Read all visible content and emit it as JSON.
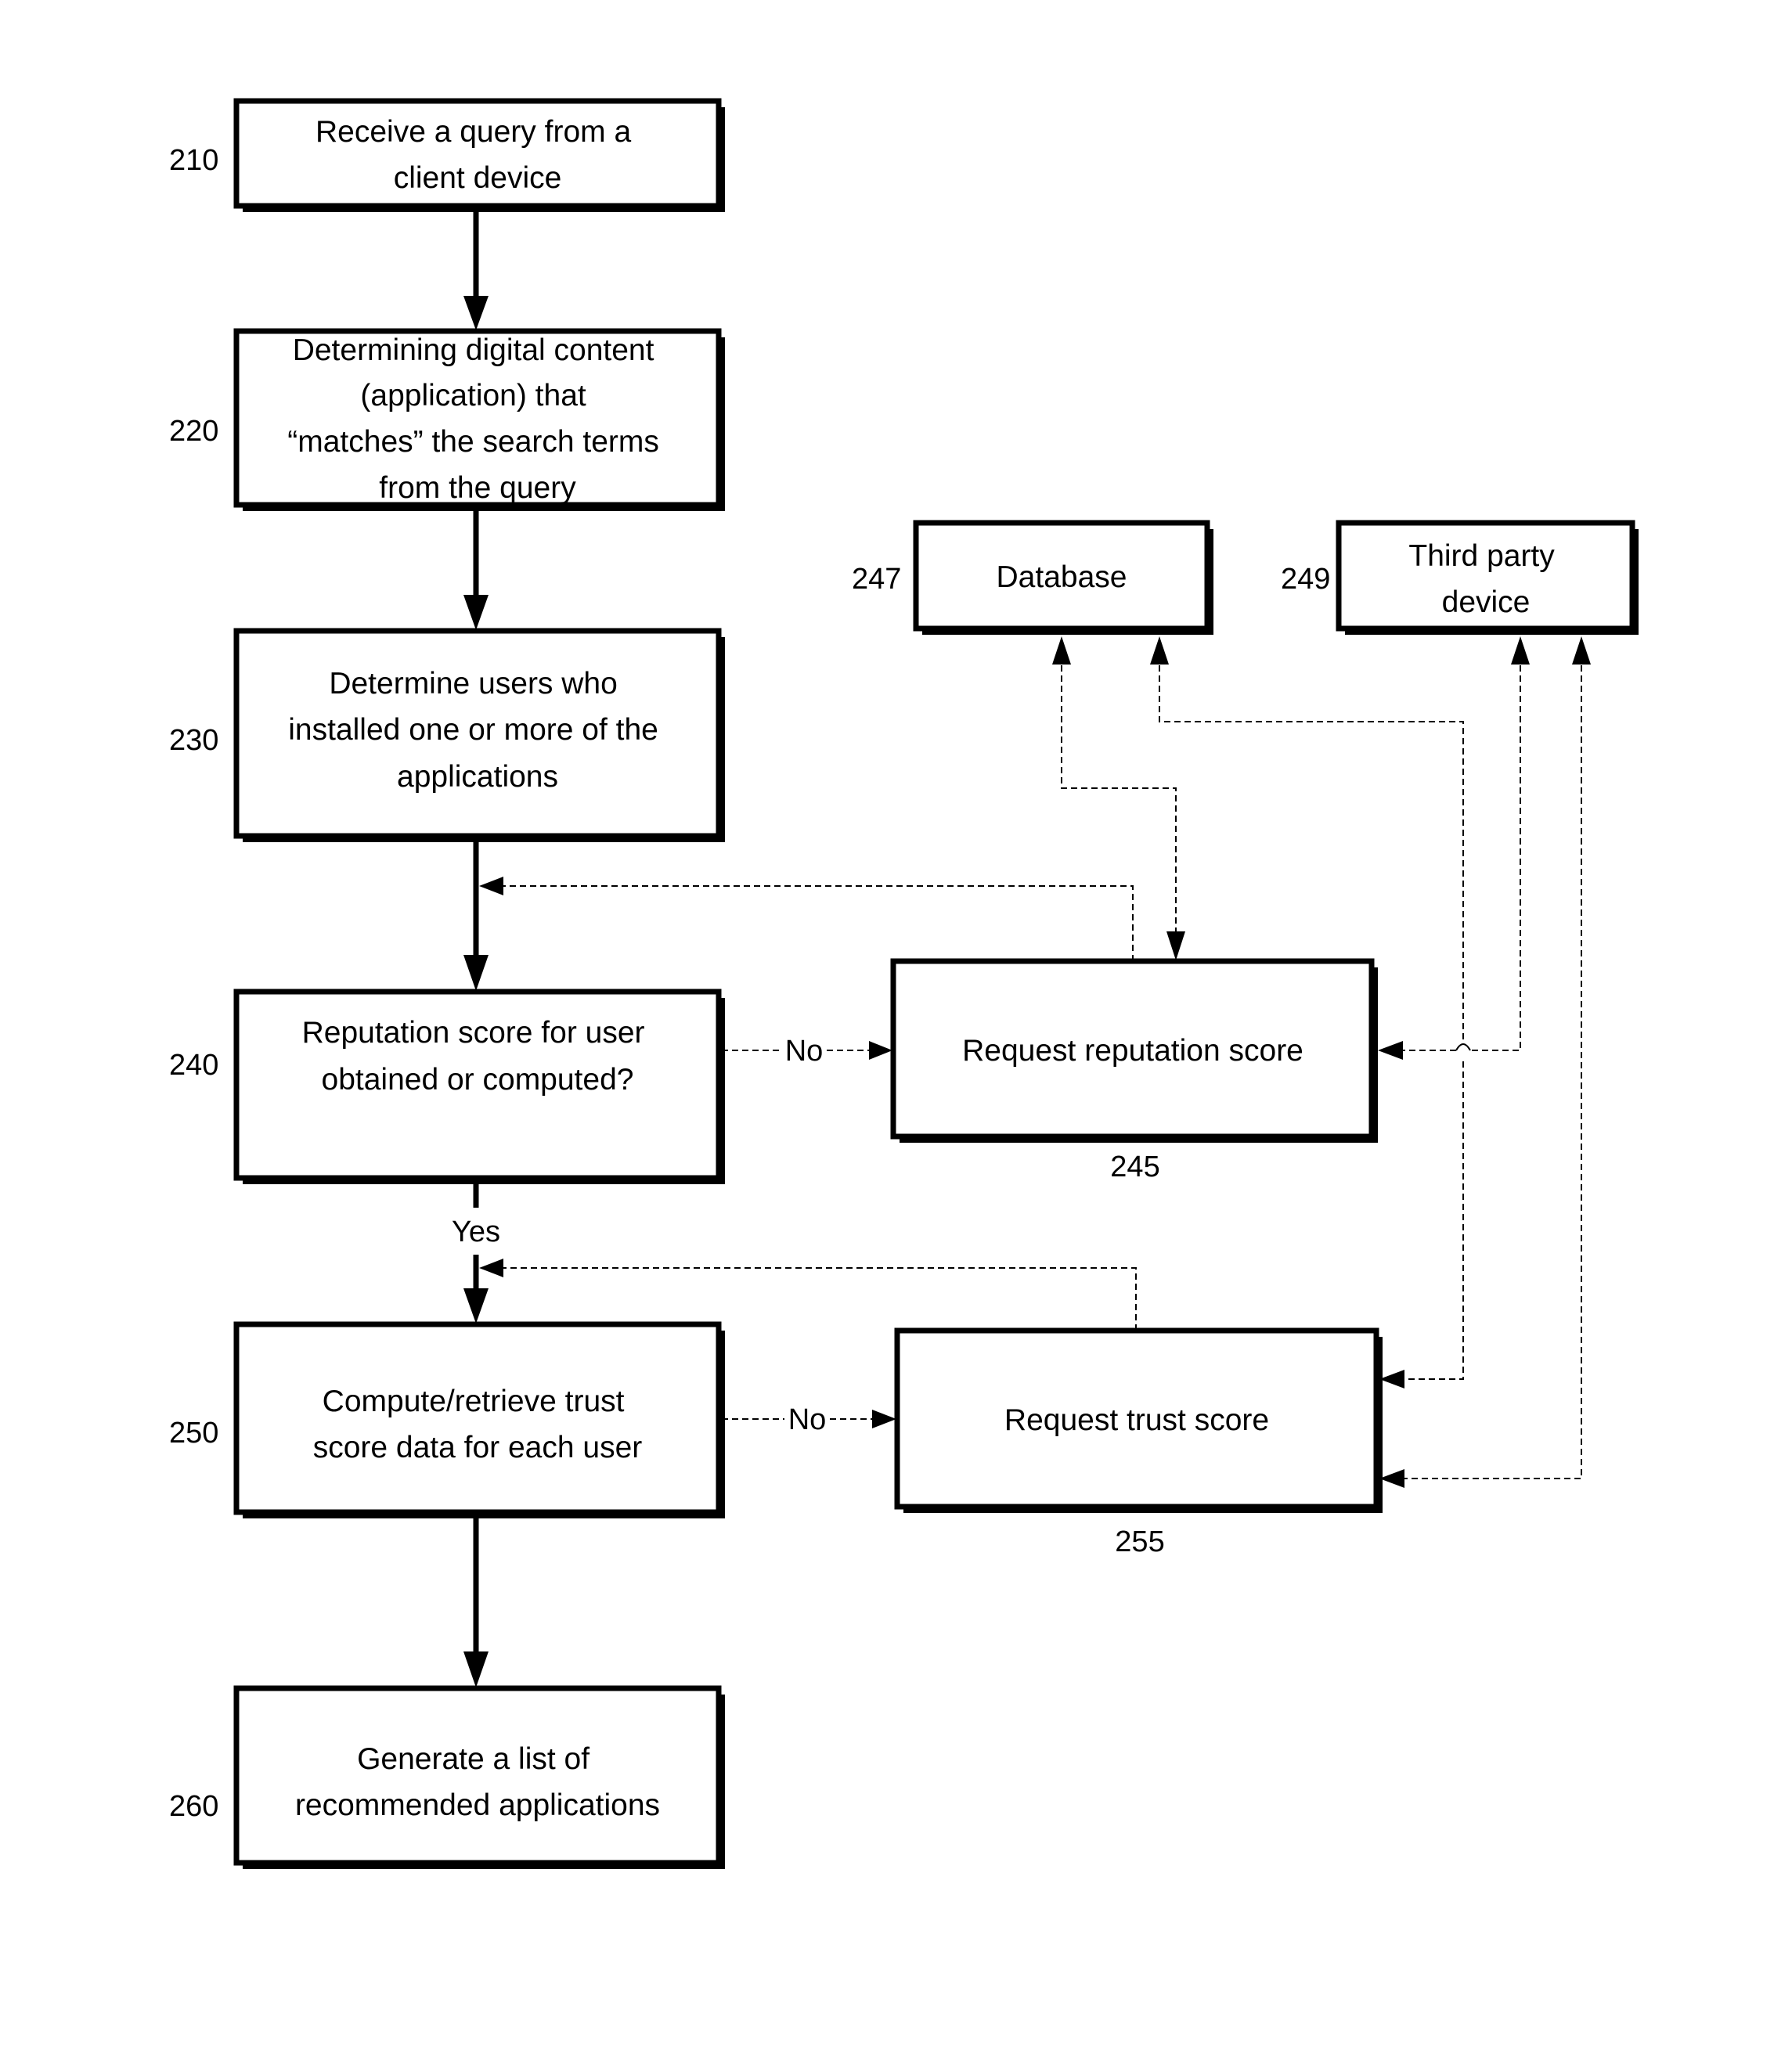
{
  "diagram": {
    "type": "flowchart",
    "steps": [
      {
        "id": "210",
        "lines": [
          "Receive a query from a",
          "client device"
        ]
      },
      {
        "id": "220",
        "lines": [
          "Determining digital content",
          "(application) that",
          "“matches” the search terms",
          "from the query"
        ]
      },
      {
        "id": "230",
        "lines": [
          "Determine users who",
          "installed one or more of the",
          "applications"
        ]
      },
      {
        "id": "240",
        "lines": [
          "Reputation score for user",
          "obtained or computed?"
        ]
      },
      {
        "id": "245",
        "lines": [
          "Request reputation score"
        ]
      },
      {
        "id": "247",
        "lines": [
          "Database"
        ]
      },
      {
        "id": "249",
        "lines": [
          "Third party",
          "device"
        ]
      },
      {
        "id": "250",
        "lines": [
          "Compute/retrieve trust",
          "score data for each user"
        ]
      },
      {
        "id": "255",
        "lines": [
          "Request trust score"
        ]
      },
      {
        "id": "260",
        "lines": [
          "Generate a list of",
          "recommended applications"
        ]
      }
    ],
    "edge_labels": {
      "no_240": "No",
      "yes_240": "Yes",
      "no_250": "No"
    },
    "edges": [
      {
        "from": "210",
        "to": "220",
        "style": "solid"
      },
      {
        "from": "220",
        "to": "230",
        "style": "solid"
      },
      {
        "from": "230",
        "to": "240",
        "style": "solid"
      },
      {
        "from": "240",
        "to": "245",
        "style": "dotted",
        "label": "No"
      },
      {
        "from": "245",
        "to": "240",
        "style": "dotted"
      },
      {
        "from": "240",
        "to": "250",
        "style": "solid",
        "label": "Yes"
      },
      {
        "from": "250",
        "to": "255",
        "style": "dotted",
        "label": "No"
      },
      {
        "from": "255",
        "to": "250",
        "style": "dotted"
      },
      {
        "from": "250",
        "to": "260",
        "style": "solid"
      },
      {
        "from": "245",
        "to": "247",
        "style": "dotted",
        "bidirectional": true
      },
      {
        "from": "255",
        "to": "247",
        "style": "dotted",
        "bidirectional": true
      },
      {
        "from": "245",
        "to": "249",
        "style": "dotted",
        "bidirectional": true
      },
      {
        "from": "255",
        "to": "249",
        "style": "dotted",
        "bidirectional": true
      }
    ]
  }
}
